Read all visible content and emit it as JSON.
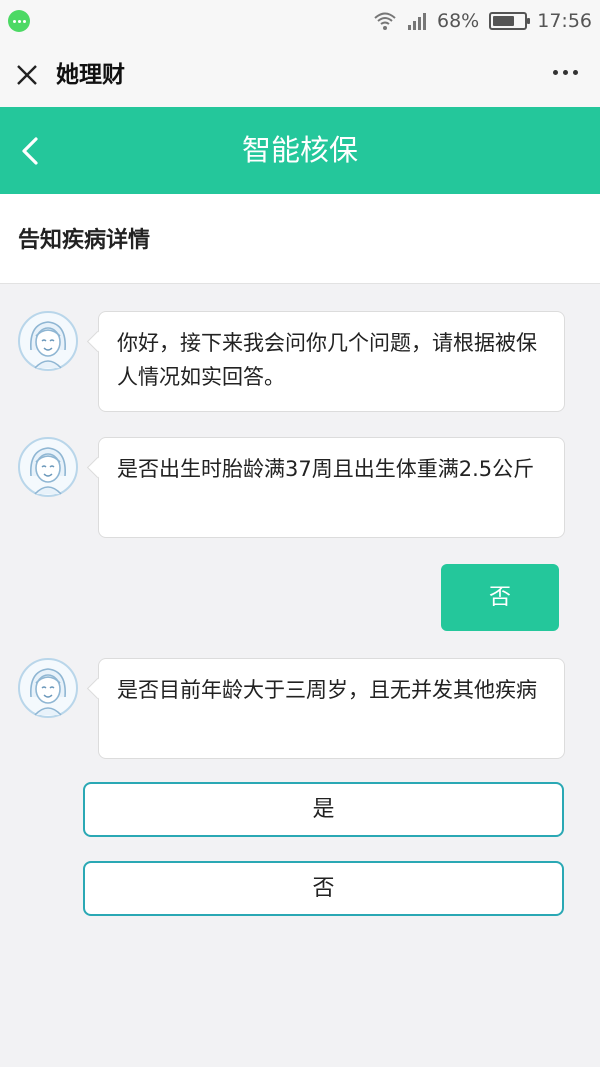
{
  "status_bar": {
    "battery": "68%",
    "battery_level": 0.68,
    "time": "17:56"
  },
  "app_bar": {
    "title": "她理财"
  },
  "header": {
    "title": "智能核保"
  },
  "section": {
    "title": "告知疾病详情"
  },
  "chat": {
    "messages": [
      {
        "text": "你好，接下来我会问你几个问题，请根据被保人情况如实回答。"
      },
      {
        "text": "是否出生时胎龄满37周且出生体重满2.5公斤"
      },
      {
        "text": "是否目前年龄大于三周岁，且无并发其他疾病"
      }
    ],
    "user_reply": "否"
  },
  "options": {
    "yes_label": "是",
    "no_label": "否"
  },
  "colors": {
    "accent": "#24c79b",
    "option_border": "#2aa8b4",
    "background": "#f2f2f4"
  }
}
